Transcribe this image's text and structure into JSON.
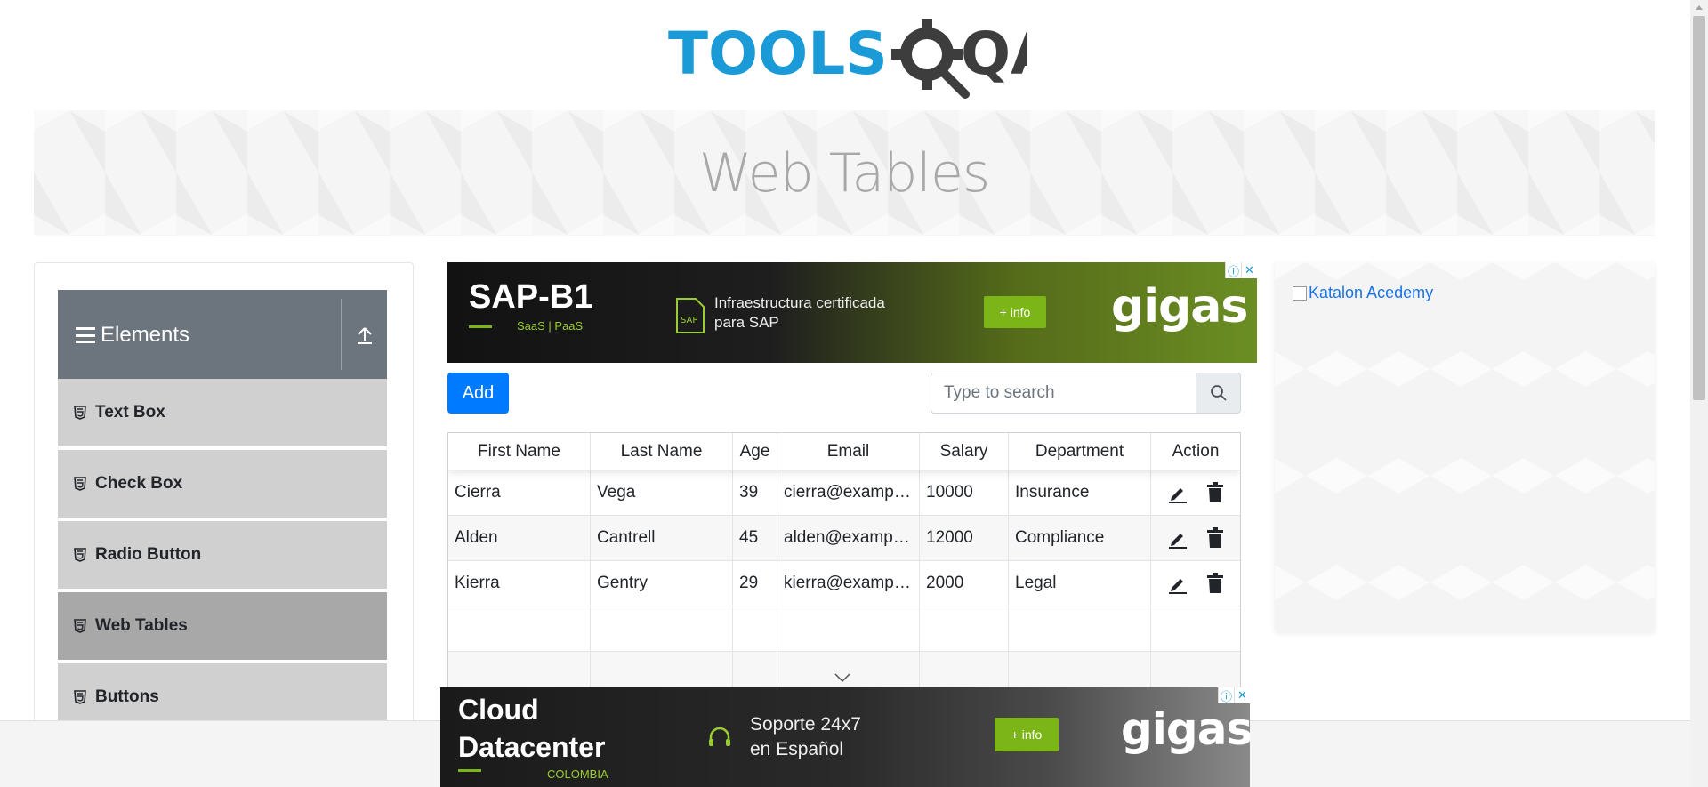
{
  "logo": {
    "text_tools": "TOOLS",
    "text_qa": "QA",
    "colors": {
      "tools": "#1a9bd7",
      "qa": "#3d3d3d"
    }
  },
  "banner": {
    "title": "Web Tables"
  },
  "sidebar": {
    "group_title": "Elements",
    "items": [
      {
        "label": "Text Box",
        "active": false
      },
      {
        "label": "Check Box",
        "active": false
      },
      {
        "label": "Radio Button",
        "active": false
      },
      {
        "label": "Web Tables",
        "active": true
      },
      {
        "label": "Buttons",
        "active": false
      }
    ]
  },
  "ad_top": {
    "headline": "SAP-B1",
    "sub": "SaaS | PaaS",
    "badge": "SAP",
    "line1": "Infraestructura certificada",
    "line2": "para SAP",
    "button": "+ info",
    "brand": "gigas"
  },
  "toolbar": {
    "add_label": "Add",
    "search_placeholder": "Type to search"
  },
  "table": {
    "headers": [
      "First Name",
      "Last Name",
      "Age",
      "Email",
      "Salary",
      "Department",
      "Action"
    ],
    "rows": [
      {
        "first": "Cierra",
        "last": "Vega",
        "age": "39",
        "email": "cierra@example.com",
        "salary": "10000",
        "department": "Insurance"
      },
      {
        "first": "Alden",
        "last": "Cantrell",
        "age": "45",
        "email": "alden@example.com",
        "salary": "12000",
        "department": "Compliance"
      },
      {
        "first": "Kierra",
        "last": "Gentry",
        "age": "29",
        "email": "kierra@example.com",
        "salary": "2000",
        "department": "Legal"
      }
    ]
  },
  "right_panel": {
    "link_text": "Katalon Acedemy"
  },
  "ad_bottom": {
    "headline1": "Cloud",
    "headline2": "Datacenter",
    "sub": "COLOMBIA",
    "line1": "Soporte 24x7",
    "line2": "en Español",
    "button": "+ info",
    "brand": "gigas"
  }
}
